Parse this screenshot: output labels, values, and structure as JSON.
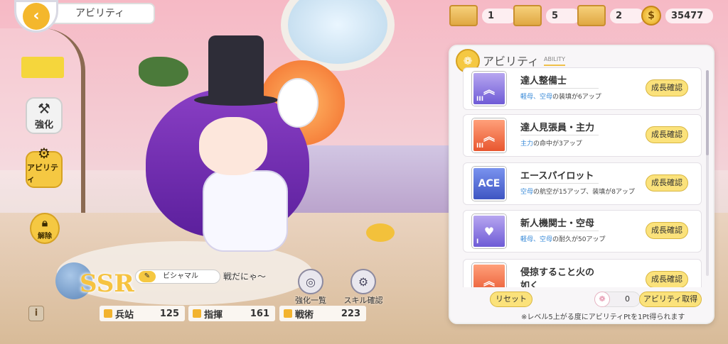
{
  "header": {
    "title": "アビリティ",
    "back_glyph": "‹"
  },
  "resources": [
    {
      "name": "box-gold",
      "value": "1"
    },
    {
      "name": "box-silver",
      "value": "5"
    },
    {
      "name": "box-gold-hat",
      "value": "2"
    },
    {
      "name": "coin",
      "value": "35477"
    }
  ],
  "side_menu": {
    "enhance": "強化",
    "ability": "アビリティ",
    "release": "解除"
  },
  "character": {
    "rarity": "SSR",
    "name": "ビシャマル",
    "catchphrase": "戦だにゃ～",
    "buttons": {
      "enhance_list": "強化一覧",
      "skill_check": "スキル確認"
    },
    "stats": [
      {
        "label": "兵站",
        "value": "125"
      },
      {
        "label": "指揮",
        "value": "161"
      },
      {
        "label": "戦術",
        "value": "223"
      }
    ]
  },
  "panel": {
    "title": "アビリティ",
    "subtitle": "ABILITY",
    "grow_label": "成長確認",
    "abilities": [
      {
        "name": "達人整備士",
        "hl": "軽母、空母",
        "rest": "の装填が6アップ",
        "icon": "purple",
        "glyph": "︽",
        "rank": "III"
      },
      {
        "name": "達人見張員・主力",
        "hl": "主力",
        "rest": "の命中が3アップ",
        "icon": "orange",
        "glyph": "︽",
        "rank": "III"
      },
      {
        "name": "エースパイロット",
        "hl": "空母",
        "rest": "の航空が15アップ、装填が8アップ",
        "icon": "blue",
        "glyph": "ACE",
        "rank": ""
      },
      {
        "name": "新人機関士・空母",
        "hl": "軽母、空母",
        "rest": "の耐久が50アップ",
        "icon": "purple",
        "glyph": "♥",
        "rank": "I"
      },
      {
        "name": "侵掠すること火の如く",
        "hl": "",
        "rest": "",
        "icon": "orange",
        "glyph": "︽",
        "rank": ""
      }
    ],
    "reset": "リセット",
    "points": "0",
    "acquire": "アビリティ取得",
    "note": "※レベル5上がる度にアビリティPtを1Pt得られます"
  }
}
